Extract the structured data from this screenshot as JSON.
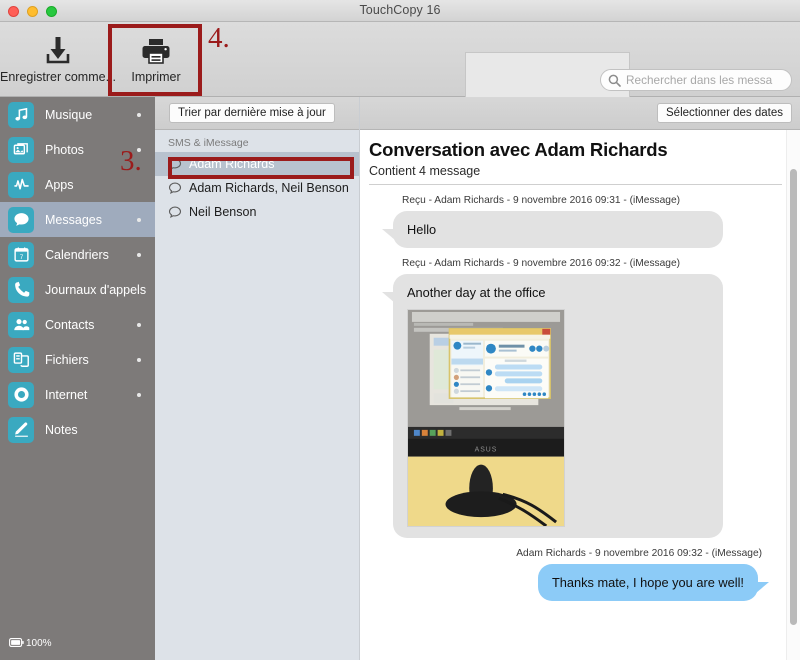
{
  "window": {
    "title": "TouchCopy 16",
    "traffic_lights": [
      "close",
      "minimize",
      "maximize"
    ]
  },
  "toolbar": {
    "buttons": [
      {
        "label": "Enregistrer comme...",
        "icon": "download-icon",
        "name": "save-as-button"
      },
      {
        "label": "Imprimer",
        "icon": "printer-icon",
        "name": "print-button"
      }
    ],
    "search": {
      "placeholder": "Rechercher dans les messa",
      "value": "",
      "icon": "search-icon"
    }
  },
  "sidebar": {
    "items": [
      {
        "label": "Musique",
        "icon": "music-note-icon",
        "active": false,
        "dot": true
      },
      {
        "label": "Photos",
        "icon": "photos-icon",
        "active": false,
        "dot": true
      },
      {
        "label": "Apps",
        "icon": "apps-icon",
        "active": false,
        "dot": false
      },
      {
        "label": "Messages",
        "icon": "chat-bubble-icon",
        "active": true,
        "dot": true
      },
      {
        "label": "Calendriers",
        "icon": "calendar-icon",
        "active": false,
        "dot": true
      },
      {
        "label": "Journaux d'appels",
        "icon": "phone-icon",
        "active": false,
        "dot": false
      },
      {
        "label": "Contacts",
        "icon": "contacts-icon",
        "active": false,
        "dot": true
      },
      {
        "label": "Fichiers",
        "icon": "files-icon",
        "active": false,
        "dot": true
      },
      {
        "label": "Internet",
        "icon": "safari-icon",
        "active": false,
        "dot": true
      },
      {
        "label": "Notes",
        "icon": "pencil-icon",
        "active": false,
        "dot": false
      }
    ],
    "battery": {
      "label": "100%",
      "icon": "battery-icon"
    }
  },
  "conversation_list": {
    "sort_button_label": "Trier par dernière mise à jour",
    "group_title": "SMS & iMessage",
    "items": [
      {
        "name": "Adam Richards",
        "selected": true
      },
      {
        "name": "Adam Richards, Neil Benson",
        "selected": false
      },
      {
        "name": "Neil Benson",
        "selected": false
      }
    ]
  },
  "thread": {
    "date_button_label": "Sélectionner des dates",
    "title": "Conversation avec Adam Richards",
    "subtitle": "Contient 4 message",
    "messages": [
      {
        "meta": "Reçu - Adam Richards - 9 novembre 2016 09:31 - (iMessage)",
        "text": "Hello",
        "direction": "in",
        "has_photo": false
      },
      {
        "meta": "Reçu - Adam Richards - 9 novembre 2016 09:32 - (iMessage)",
        "text": "Another day at the office",
        "direction": "in",
        "has_photo": true,
        "photo_alt": "Photo of an ASUS monitor on a desk showing a messaging application"
      },
      {
        "meta": "Adam Richards - 9 novembre 2016 09:32 - (iMessage)",
        "text": "Thanks mate, I hope you are well!",
        "direction": "out",
        "has_photo": false
      }
    ]
  },
  "annotations": [
    {
      "number": "4.",
      "target": "print-button"
    },
    {
      "number": "3.",
      "target": "conversation-adam-richards"
    }
  ],
  "colors": {
    "sidebar_bg": "#7d7a79",
    "sidebar_icon": "#3aa9c0",
    "sidebar_active": "#9fabbd",
    "conv_list_bg": "#dde2e8",
    "conv_selected": "#b8c2ce",
    "bubble_in": "#e2e2e2",
    "bubble_out": "#8ccbf7",
    "annotation_red": "#9b1b1b"
  }
}
